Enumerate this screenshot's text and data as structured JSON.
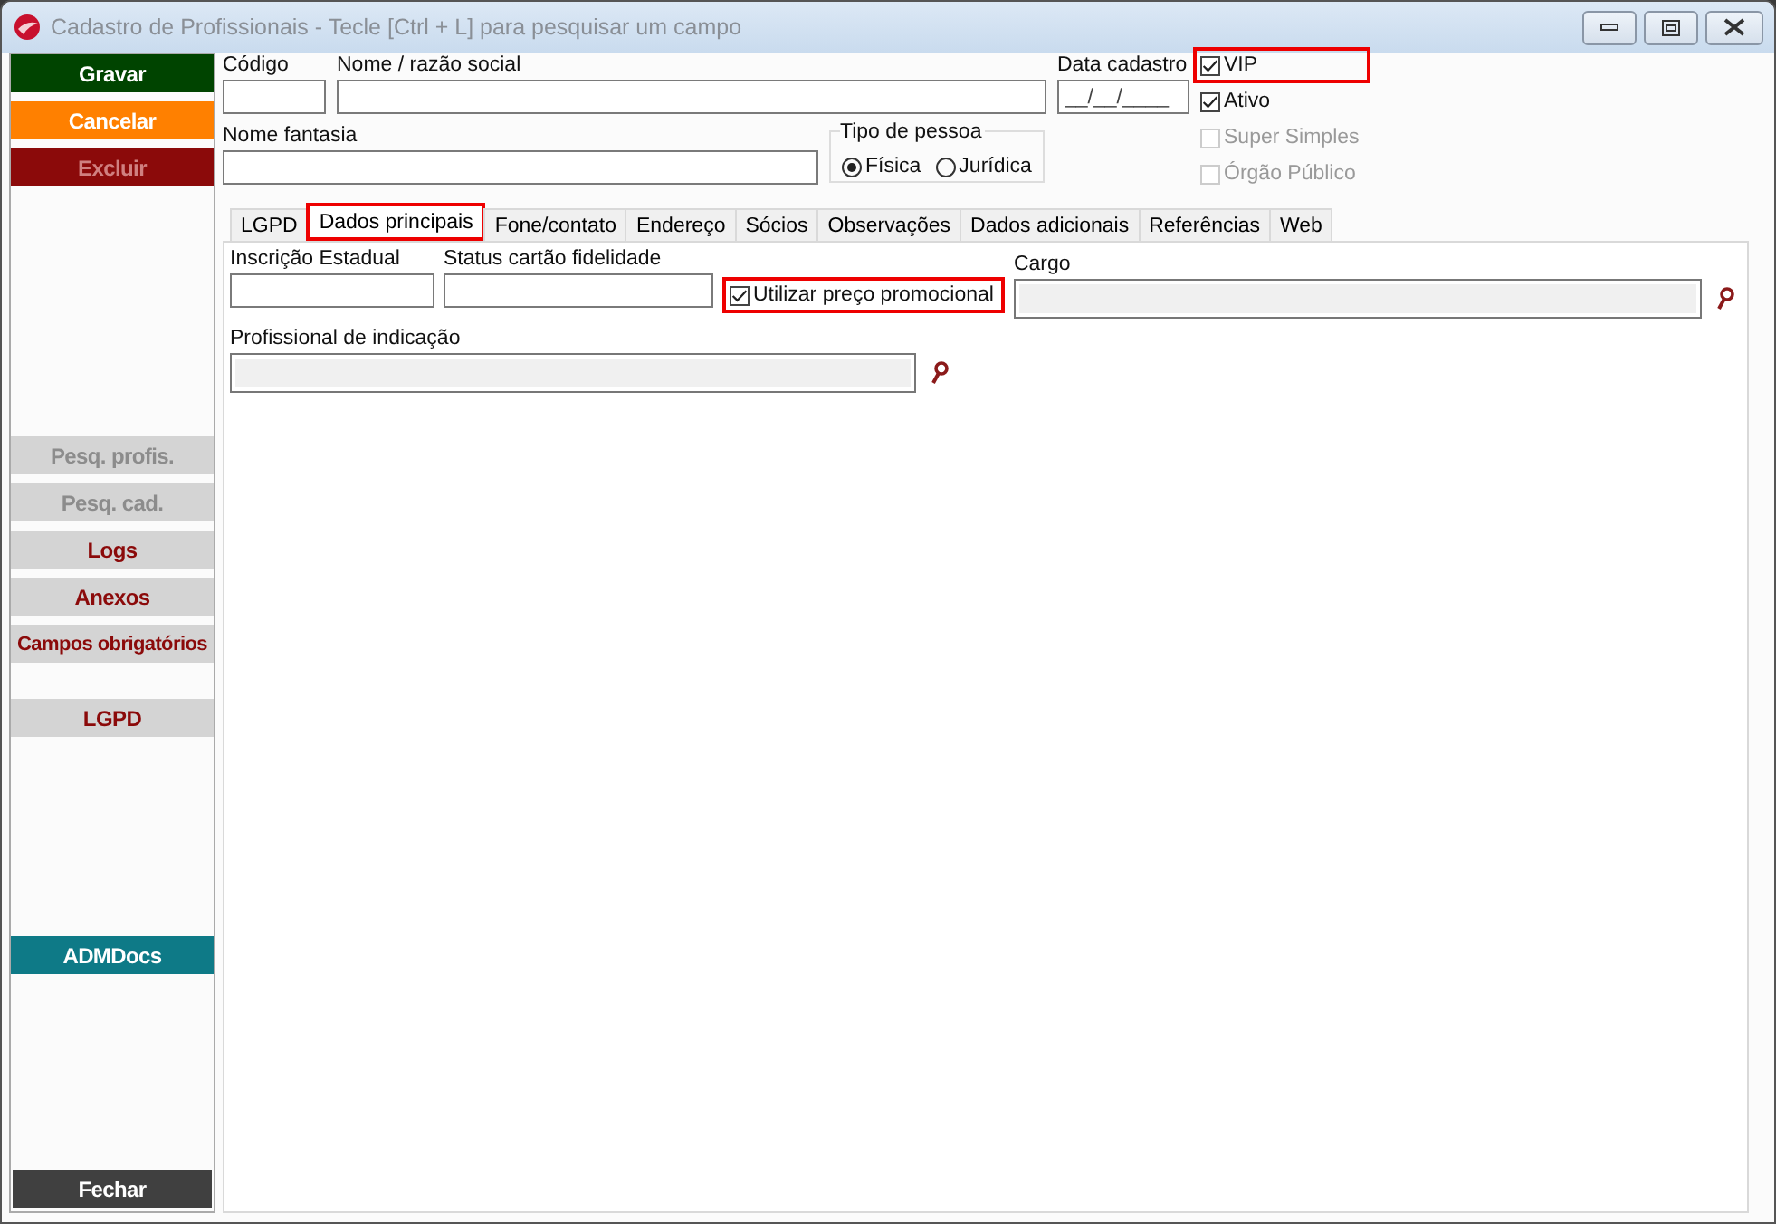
{
  "window": {
    "title": "Cadastro de Profissionais - Tecle [Ctrl + L] para pesquisar um campo"
  },
  "sidebar": {
    "sections": [
      [
        {
          "label": "Gravar",
          "kind": "save",
          "disabled": false
        },
        {
          "label": "Cancelar",
          "kind": "cancel",
          "disabled": false
        },
        {
          "label": "Excluir",
          "kind": "delete",
          "disabled": true
        }
      ],
      [
        {
          "label": "Pesq. profis.",
          "kind": "neutral",
          "disabled": true
        },
        {
          "label": "Pesq. cad.",
          "kind": "neutral",
          "disabled": true
        },
        {
          "label": "Logs",
          "kind": "neutral",
          "disabled": false
        },
        {
          "label": "Anexos",
          "kind": "neutral",
          "disabled": false
        },
        {
          "label": "Campos obrigatórios",
          "kind": "neutral",
          "disabled": false
        }
      ],
      [
        {
          "label": "LGPD",
          "kind": "neutral",
          "disabled": false
        }
      ],
      [
        {
          "label": "ADMDocs",
          "kind": "teal",
          "disabled": false
        }
      ],
      [
        {
          "label": "Fechar",
          "kind": "close",
          "disabled": false
        }
      ]
    ]
  },
  "header": {
    "codigo": {
      "label": "Código"
    },
    "nome": {
      "label": "Nome / razão social"
    },
    "data_cadastro": {
      "label": "Data cadastro",
      "value": "__/__/____"
    },
    "nome_fantasia": {
      "label": "Nome fantasia"
    },
    "tipo_pessoa": {
      "label": "Tipo de pessoa",
      "options": [
        {
          "label": "Física",
          "selected": true
        },
        {
          "label": "Jurídica",
          "selected": false
        }
      ]
    },
    "flags": [
      {
        "label": "VIP",
        "checked": true,
        "disabled": false,
        "highlighted": true
      },
      {
        "label": "Ativo",
        "checked": true,
        "disabled": false,
        "highlighted": false
      },
      {
        "label": "Super Simples",
        "checked": false,
        "disabled": true,
        "highlighted": false
      },
      {
        "label": "Órgão Público",
        "checked": false,
        "disabled": true,
        "highlighted": false
      }
    ]
  },
  "tabs": [
    {
      "label": "LGPD",
      "selected": false,
      "highlighted": false
    },
    {
      "label": "Dados principais",
      "selected": true,
      "highlighted": true
    },
    {
      "label": "Fone/contato",
      "selected": false,
      "highlighted": false
    },
    {
      "label": "Endereço",
      "selected": false,
      "highlighted": false
    },
    {
      "label": "Sócios",
      "selected": false,
      "highlighted": false
    },
    {
      "label": "Observações",
      "selected": false,
      "highlighted": false
    },
    {
      "label": "Dados adicionais",
      "selected": false,
      "highlighted": false
    },
    {
      "label": "Referências",
      "selected": false,
      "highlighted": false
    },
    {
      "label": "Web",
      "selected": false,
      "highlighted": false
    }
  ],
  "panel": {
    "inscricao_estadual": {
      "label": "Inscrição Estadual"
    },
    "status_cartao": {
      "label": "Status cartão fidelidade"
    },
    "preco_promocional": {
      "label": "Utilizar preço promocional",
      "checked": true,
      "highlighted": true
    },
    "cargo": {
      "label": "Cargo"
    },
    "profissional_indicacao": {
      "label": "Profissional de indicação"
    }
  }
}
